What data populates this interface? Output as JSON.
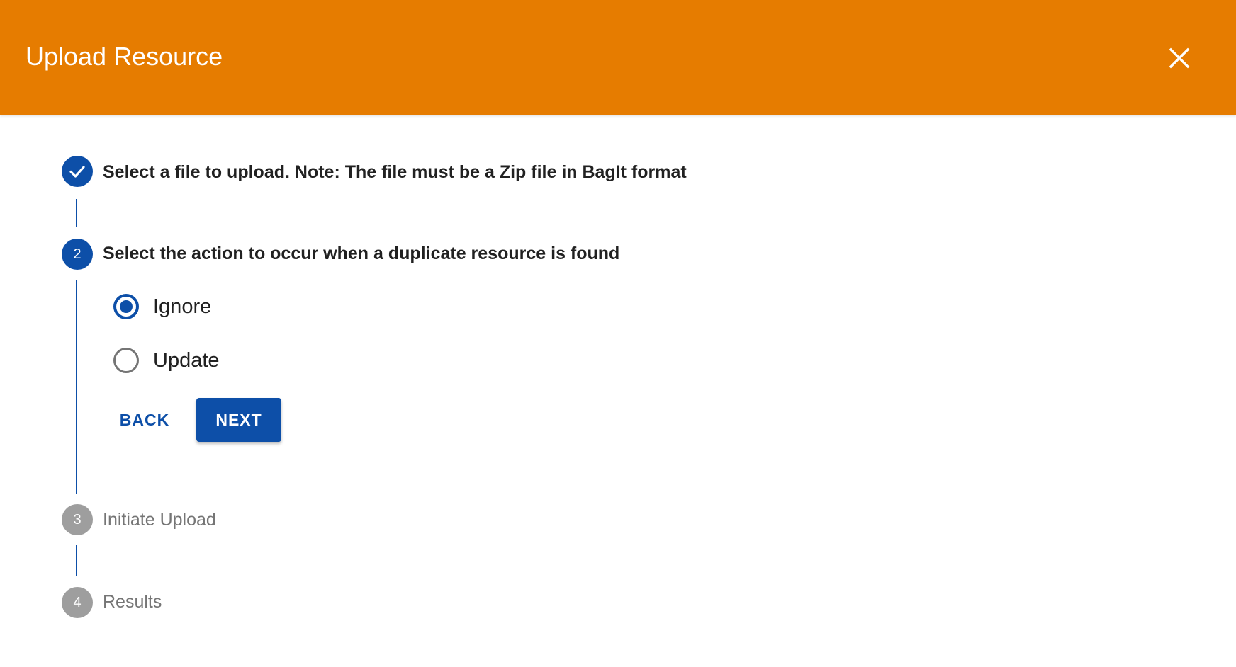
{
  "header": {
    "title": "Upload Resource",
    "close_icon": "close-icon",
    "color": "#e67c00"
  },
  "accent_color": "#0d4fa8",
  "steps": [
    {
      "number": "1",
      "label": "Select a file to upload. Note: The file must be a Zip file in BagIt format",
      "status": "completed",
      "icon": "check-icon"
    },
    {
      "number": "2",
      "label": "Select the action to occur when a duplicate resource is found",
      "status": "active"
    },
    {
      "number": "3",
      "label": "Initiate Upload",
      "status": "inactive"
    },
    {
      "number": "4",
      "label": "Results",
      "status": "inactive"
    }
  ],
  "duplicate_action": {
    "options": [
      {
        "label": "Ignore",
        "checked": true
      },
      {
        "label": "Update",
        "checked": false
      }
    ]
  },
  "buttons": {
    "back": "BACK",
    "next": "NEXT"
  }
}
